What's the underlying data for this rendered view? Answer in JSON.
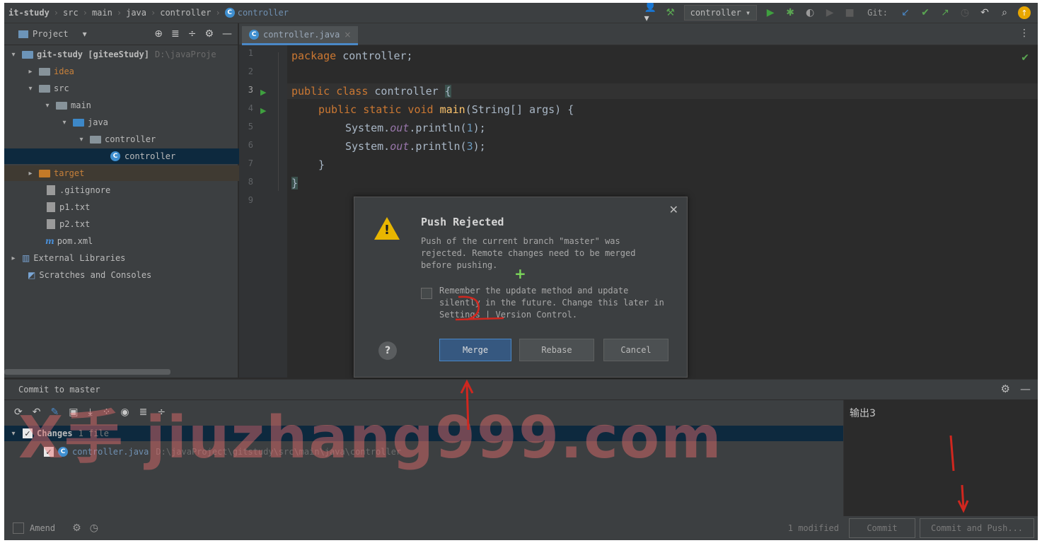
{
  "breadcrumbs": [
    "it-study",
    "src",
    "main",
    "java",
    "controller",
    "controller"
  ],
  "run_config": "controller",
  "git_label": "Git:",
  "colors": {
    "accent": "#4a88c7",
    "run": "#3fa03f",
    "warning": "#e8b600",
    "selection": "#0d293e"
  },
  "project_panel": {
    "title": "Project",
    "tree": [
      {
        "label": "git-study [giteeStudy]",
        "hint": "D:\\javaProje"
      },
      {
        "label": "idea"
      },
      {
        "label": "src"
      },
      {
        "label": "main"
      },
      {
        "label": "java"
      },
      {
        "label": "controller"
      },
      {
        "label": "controller"
      },
      {
        "label": "target"
      },
      {
        "label": ".gitignore"
      },
      {
        "label": "p1.txt"
      },
      {
        "label": "p2.txt"
      },
      {
        "label": "pom.xml"
      },
      {
        "label": "External Libraries"
      },
      {
        "label": "Scratches and Consoles"
      }
    ]
  },
  "editor": {
    "tab": "controller.java",
    "line_numbers": [
      "1",
      "2",
      "3",
      "4",
      "5",
      "6",
      "7",
      "8",
      "9"
    ],
    "code": {
      "l1_kw": "package",
      "l1_rest": " controller;",
      "l3_kw": "public class",
      "l3_name": " controller ",
      "l3_brace": "{",
      "l4_kw": "public static void",
      "l4_name": " main",
      "l4_rest": "(String[] args) {",
      "l5_a": "System.",
      "l5_f": "out",
      "l5_b": ".println(",
      "l5_n": "1",
      "l5_c": ");",
      "l6_a": "System.",
      "l6_f": "out",
      "l6_b": ".println(",
      "l6_n": "3",
      "l6_c": ");",
      "l7": "}",
      "l8": "}"
    }
  },
  "dialog": {
    "title": "Push Rejected",
    "message": "Push of the current branch \"master\" was rejected.  Remote changes need to be merged before pushing.",
    "remember": "Remember the update method and update silently in the future. Change this later in Settings | Version Control.",
    "help": "?",
    "merge": "Merge",
    "rebase": "Rebase",
    "cancel": "Cancel"
  },
  "commit_panel": {
    "title": "Commit to master",
    "changes_label": "Changes",
    "changes_count": "1 file",
    "file_name": "controller.java",
    "file_path": "D:\\javaProject\\gitstudy\\src\\main\\java\\controller",
    "amend": "Amend",
    "modified": "1 modified",
    "commit_message": "输出3",
    "commit_btn": "Commit",
    "commit_push_btn": "Commit and Push..."
  },
  "watermark": "X手 jiuzhang999.com"
}
